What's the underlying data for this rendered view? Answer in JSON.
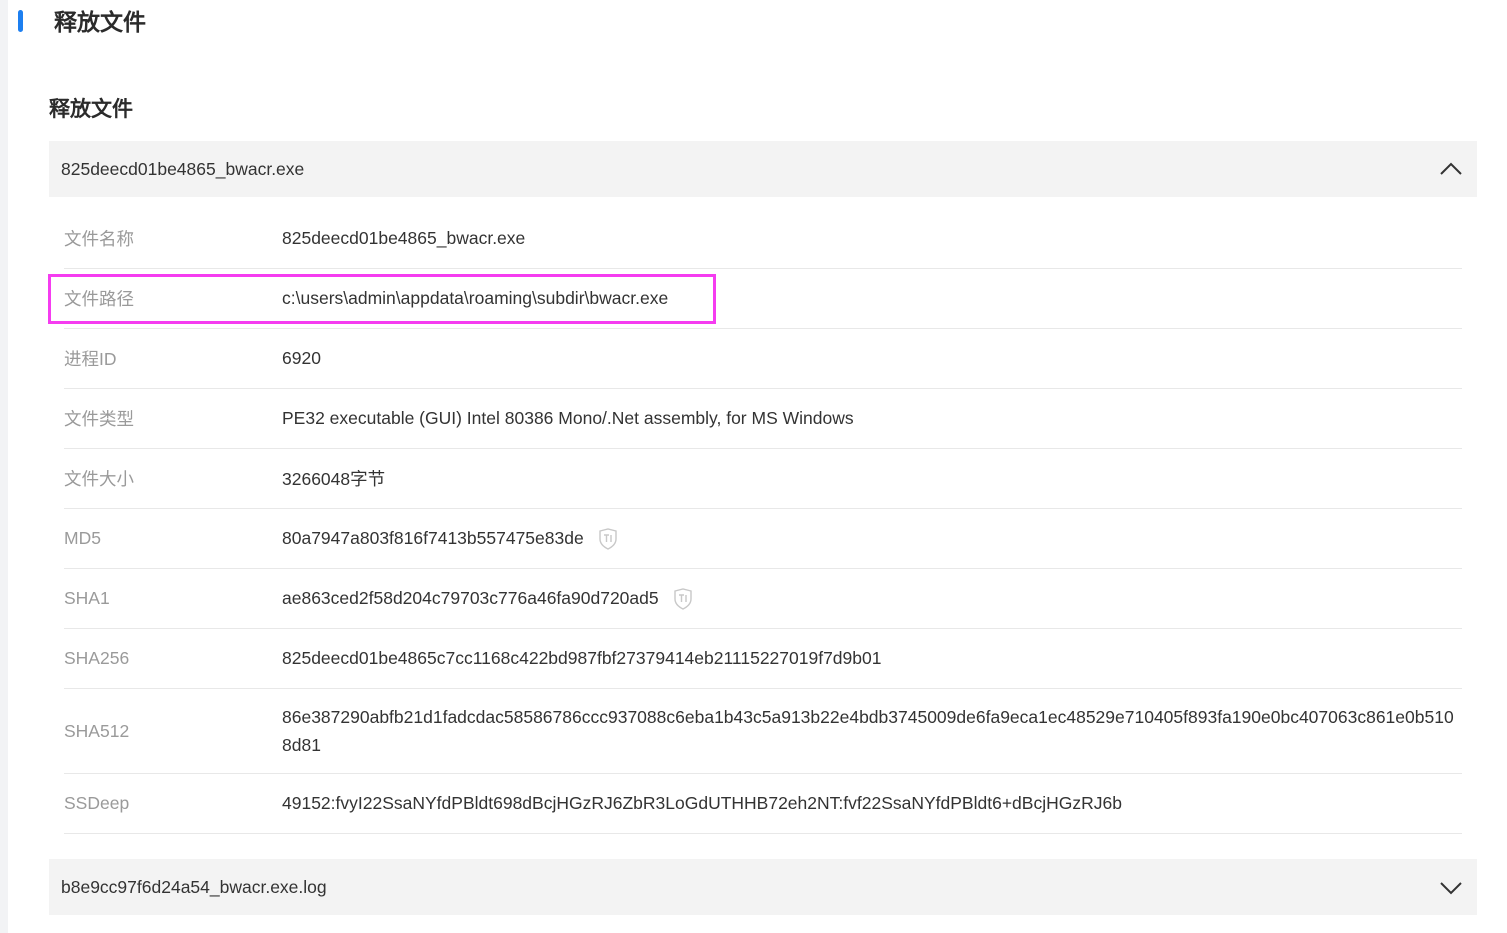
{
  "page": {
    "title": "释放文件",
    "section_title": "释放文件"
  },
  "files": [
    {
      "name": "825deecd01be4865_bwacr.exe",
      "expanded": true,
      "details": {
        "file_name": {
          "label": "文件名称",
          "value": "825deecd01be4865_bwacr.exe"
        },
        "file_path": {
          "label": "文件路径",
          "value": "c:\\users\\admin\\appdata\\roaming\\subdir\\bwacr.exe"
        },
        "process_id": {
          "label": "进程ID",
          "value": "6920"
        },
        "file_type": {
          "label": "文件类型",
          "value": "PE32 executable (GUI) Intel 80386 Mono/.Net assembly, for MS Windows"
        },
        "file_size": {
          "label": "文件大小",
          "value": "3266048字节"
        },
        "md5": {
          "label": "MD5",
          "value": "80a7947a803f816f7413b557475e83de"
        },
        "sha1": {
          "label": "SHA1",
          "value": "ae863ced2f58d204c79703c776a46fa90d720ad5"
        },
        "sha256": {
          "label": "SHA256",
          "value": "825deecd01be4865c7cc1168c422bd987fbf27379414eb21115227019f7d9b01"
        },
        "sha512": {
          "label": "SHA512",
          "value": "86e387290abfb21d1fadcdac58586786ccc937088c6eba1b43c5a913b22e4bdb3745009de6fa9eca1ec48529e710405f893fa190e0bc407063c861e0b5108d81"
        },
        "ssdeep": {
          "label": "SSDeep",
          "value": "49152:fvyI22SsaNYfdPBldt698dBcjHGzRJ6ZbR3LoGdUTHHB72eh2NT:fvf22SsaNYfdPBldt6+dBcjHGzRJ6b"
        }
      }
    },
    {
      "name": "b8e9cc97f6d24a54_bwacr.exe.log",
      "expanded": false
    }
  ],
  "icons": {
    "expanded_chevron": "chevron-up-icon",
    "collapsed_chevron": "chevron-down-icon",
    "threat_intel": "ti-shield-icon"
  },
  "colors": {
    "accent": "#1d7ff0",
    "highlight": "#f53cf0",
    "header_bg": "#f3f3f3",
    "label_text": "#9a9a9a",
    "value_text": "#333333"
  }
}
